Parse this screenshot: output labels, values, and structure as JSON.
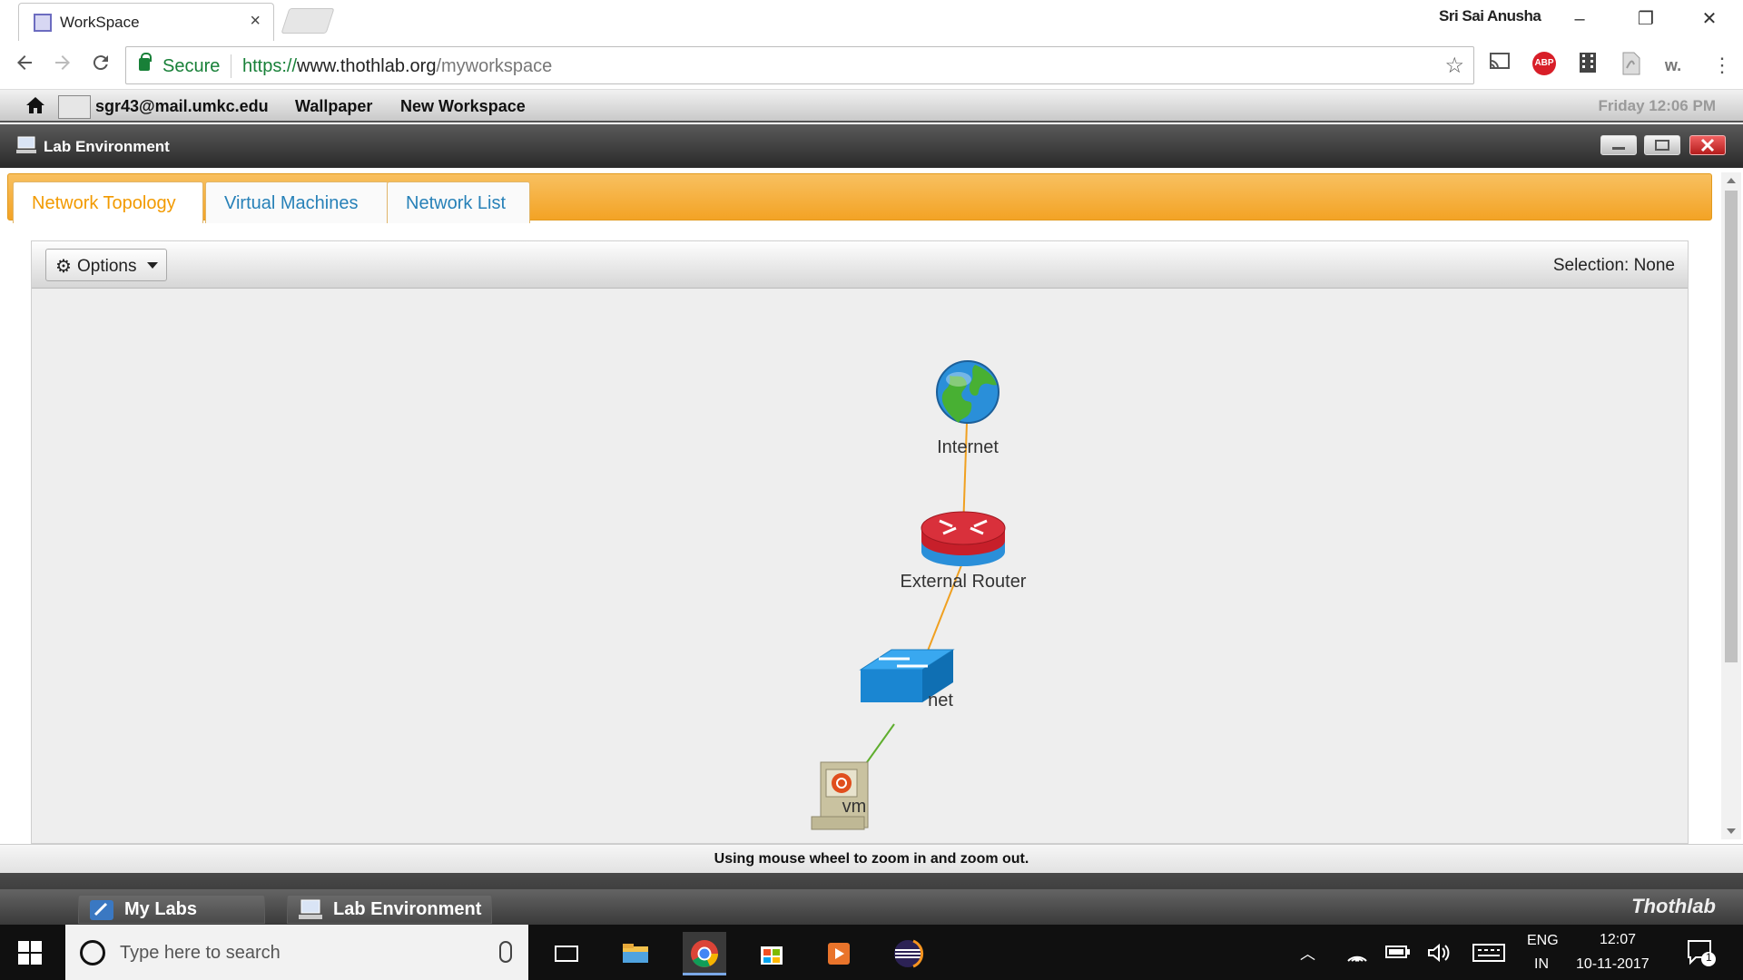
{
  "browser": {
    "tab_title": "WorkSpace",
    "tab_close": "×",
    "profile_name": "Sri Sai Anusha",
    "window_controls": {
      "minimize": "–",
      "restore": "❐",
      "close": "✕"
    },
    "security_label": "Secure",
    "url_scheme": "https://",
    "url_host": "www.thothlab.org",
    "url_path": "/myworkspace",
    "extensions": [
      "cast-icon",
      "adblock-icon",
      "film-icon",
      "pdf-icon",
      "w-icon",
      "menu-icon"
    ],
    "abp_label": "ABP",
    "w_label": "w."
  },
  "appbar": {
    "user_email": "sgr43@mail.umkc.edu",
    "wallpaper_label": "Wallpaper",
    "new_workspace_label": "New Workspace",
    "clock": "Friday 12:06 PM"
  },
  "window": {
    "title": "Lab Environment"
  },
  "tabs": [
    {
      "label": "Network Topology",
      "active": true
    },
    {
      "label": "Virtual Machines",
      "active": false
    },
    {
      "label": "Network List",
      "active": false
    }
  ],
  "panel": {
    "options_label": "Options",
    "selection_text": "Selection: None"
  },
  "topology": {
    "nodes": [
      {
        "id": "internet",
        "label": "Internet",
        "type": "globe"
      },
      {
        "id": "router",
        "label": "External Router",
        "type": "router"
      },
      {
        "id": "net",
        "label": "net",
        "type": "switch"
      },
      {
        "id": "vm",
        "label": "vm",
        "type": "computer"
      }
    ],
    "links": [
      {
        "from": "internet",
        "to": "router",
        "color": "#f0a020"
      },
      {
        "from": "router",
        "to": "net",
        "color": "#f0a020"
      },
      {
        "from": "net",
        "to": "vm",
        "color": "#5fae2e"
      }
    ]
  },
  "hint_text": "Using mouse wheel to zoom in and zoom out.",
  "tray": {
    "items": [
      {
        "label": "My Labs"
      },
      {
        "label": "Lab Environment"
      }
    ],
    "brand": "Thothlab"
  },
  "taskbar": {
    "search_placeholder": "Type here to search",
    "language": "ENG",
    "region": "IN",
    "time": "12:07",
    "date": "10-11-2017",
    "notification_count": "1"
  },
  "colors": {
    "accent_orange": "#f3a325",
    "tab_link_blue": "#2781b8",
    "secure_green": "#188038"
  }
}
